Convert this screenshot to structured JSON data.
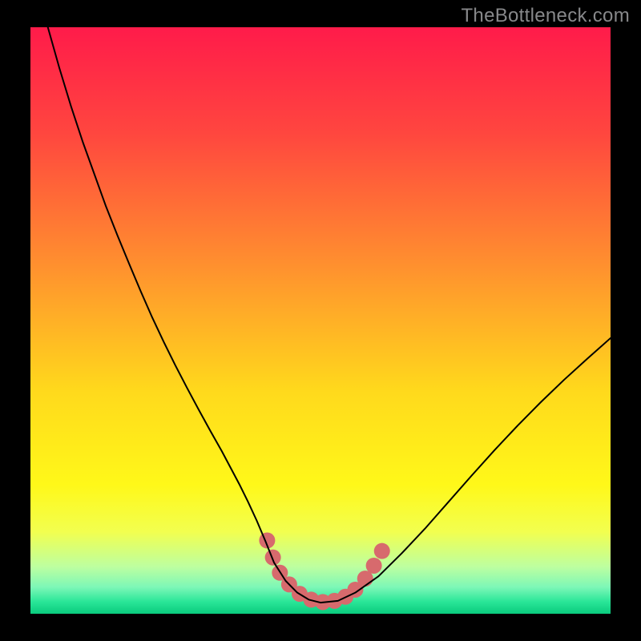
{
  "watermark": {
    "text": "TheBottleneck.com"
  },
  "chart_data": {
    "type": "line",
    "title": "",
    "xlabel": "",
    "ylabel": "",
    "xlim": [
      0,
      100
    ],
    "ylim": [
      0,
      100
    ],
    "grid": false,
    "legend": false,
    "background": {
      "type": "vertical-gradient",
      "stops": [
        {
          "pos": 0.0,
          "color": "#ff1b4a"
        },
        {
          "pos": 0.18,
          "color": "#ff463f"
        },
        {
          "pos": 0.4,
          "color": "#ff8e2f"
        },
        {
          "pos": 0.62,
          "color": "#ffd91c"
        },
        {
          "pos": 0.78,
          "color": "#fff819"
        },
        {
          "pos": 0.86,
          "color": "#f2ff4f"
        },
        {
          "pos": 0.92,
          "color": "#bdffa0"
        },
        {
          "pos": 0.955,
          "color": "#7cf7b7"
        },
        {
          "pos": 0.98,
          "color": "#28e597"
        },
        {
          "pos": 1.0,
          "color": "#0acb7d"
        }
      ]
    },
    "series": [
      {
        "name": "bottleneck-curve",
        "color": "#000000",
        "width": 2,
        "x": [
          3,
          5,
          7,
          9,
          11,
          13,
          15,
          17,
          19,
          21,
          23,
          25,
          27,
          29,
          31,
          33,
          34.5,
          36,
          37.5,
          39,
          40.5,
          42,
          44,
          46,
          48,
          50,
          53,
          56,
          60,
          64,
          68,
          72,
          76,
          80,
          84,
          88,
          92,
          96,
          100
        ],
        "y": [
          100,
          93,
          86.5,
          80.5,
          75,
          69.5,
          64.5,
          59.7,
          55,
          50.5,
          46.3,
          42.3,
          38.5,
          34.8,
          31.2,
          27.7,
          24.9,
          22.1,
          19.1,
          15.9,
          12.4,
          8.7,
          5.6,
          3.6,
          2.4,
          1.9,
          2.2,
          3.6,
          6.4,
          10.3,
          14.5,
          19.0,
          23.5,
          27.9,
          32.1,
          36.1,
          39.9,
          43.5,
          47.0
        ]
      }
    ],
    "markers": {
      "name": "lowest-bottleneck-range",
      "color": "#d76a6d",
      "radius": 10,
      "points": [
        {
          "x": 40.8,
          "y": 12.5
        },
        {
          "x": 41.8,
          "y": 9.6
        },
        {
          "x": 43.0,
          "y": 7.0
        },
        {
          "x": 44.6,
          "y": 5.0
        },
        {
          "x": 46.4,
          "y": 3.4
        },
        {
          "x": 48.4,
          "y": 2.4
        },
        {
          "x": 50.4,
          "y": 2.0
        },
        {
          "x": 52.4,
          "y": 2.2
        },
        {
          "x": 54.3,
          "y": 2.9
        },
        {
          "x": 56.0,
          "y": 4.1
        },
        {
          "x": 57.7,
          "y": 6.0
        },
        {
          "x": 59.2,
          "y": 8.2
        },
        {
          "x": 60.6,
          "y": 10.7
        }
      ]
    }
  }
}
